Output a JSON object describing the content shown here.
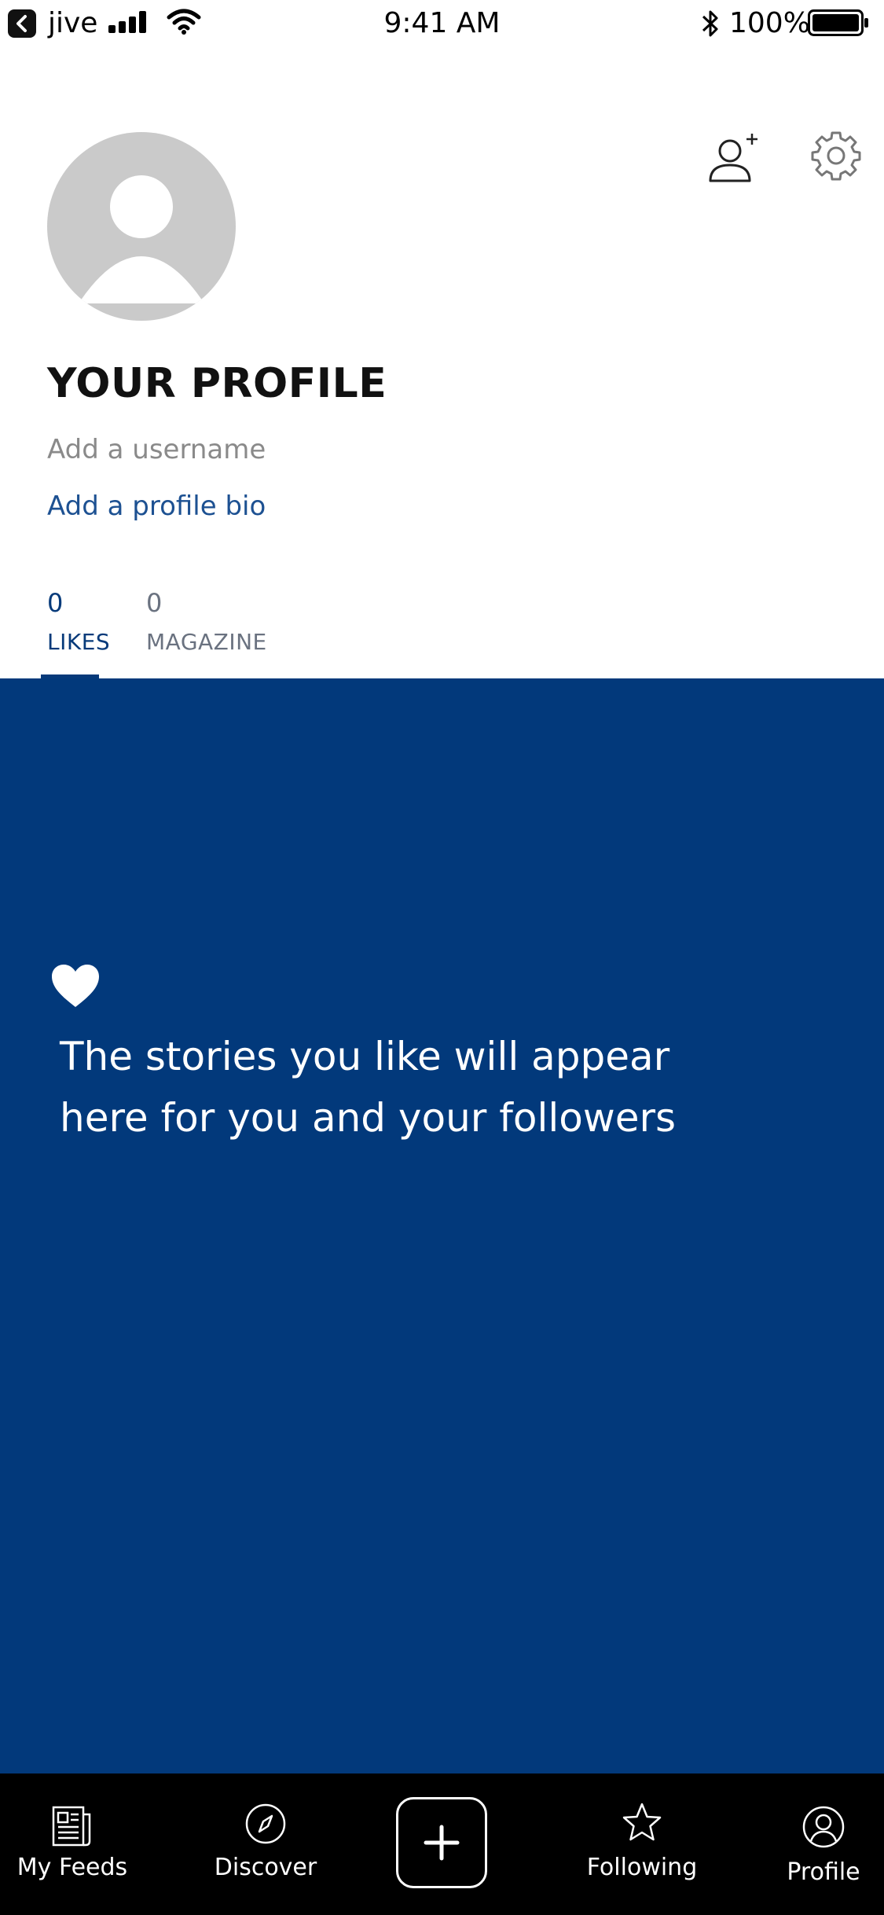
{
  "status_bar": {
    "back_app": "jive",
    "time": "9:41 AM",
    "battery": "100%"
  },
  "profile": {
    "title": "YOUR PROFILE",
    "username_prompt": "Add a username",
    "bio_prompt": "Add a profile bio"
  },
  "tabs": [
    {
      "count": "0",
      "label": "LIKES",
      "active": true
    },
    {
      "count": "0",
      "label": "MAGAZINE",
      "active": false
    }
  ],
  "empty_state": {
    "icon": "heart-icon",
    "line1": "The stories you like will appear",
    "line2": "here for you and your followers"
  },
  "bottom_nav": {
    "items": [
      {
        "label": "My Feeds",
        "icon": "newspaper-icon"
      },
      {
        "label": "Discover",
        "icon": "compass-icon"
      },
      {
        "label": "",
        "icon": "plus-icon"
      },
      {
        "label": "Following",
        "icon": "star-icon"
      },
      {
        "label": "Profile",
        "icon": "person-circle-icon"
      }
    ]
  },
  "colors": {
    "brand_blue": "#02397b",
    "link_blue": "#1d5192",
    "tab_active": "#063a7a",
    "avatar_gray": "#cacaca"
  }
}
